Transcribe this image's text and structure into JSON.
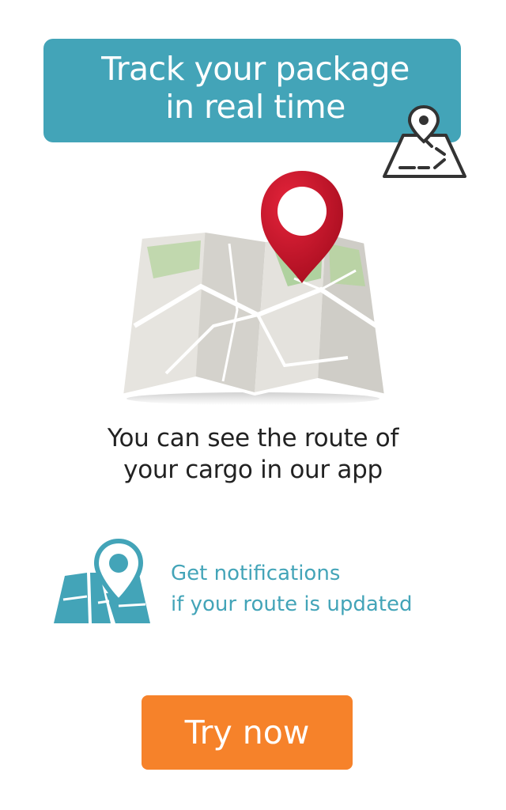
{
  "banner": {
    "title_line1": "Track your package",
    "title_line2": "in real time"
  },
  "subtitle": {
    "line1": "You can see the route of",
    "line2": "your cargo in our app"
  },
  "notice": {
    "line1": "Get notifications",
    "line2": "if your route is updated"
  },
  "cta": {
    "label": "Try now"
  },
  "icons": {
    "badge": "map-route-pin-icon",
    "hero": "folded-map-with-pin-illustration",
    "notice": "map-pin-icon"
  },
  "colors": {
    "accent_teal": "#43a4b8",
    "cta_orange": "#f6822a",
    "pin_red": "#c8102e",
    "text_dark": "#222222"
  }
}
